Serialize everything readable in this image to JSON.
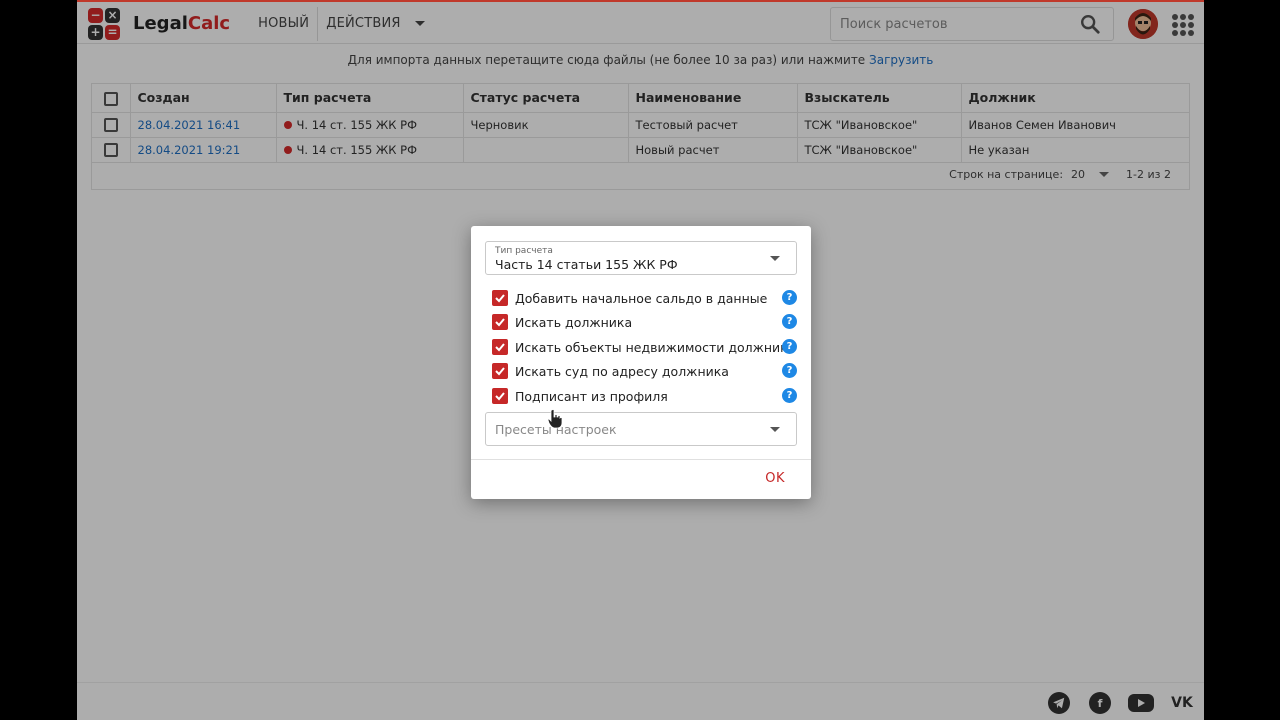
{
  "header": {
    "brand_part1": "Legal",
    "brand_part2": "Calc",
    "logo_symbols": [
      "−",
      "×",
      "+",
      "="
    ],
    "nav_new": "НОВЫЙ",
    "nav_actions": "ДЕЙСТВИЯ",
    "search_placeholder": "Поиск расчетов"
  },
  "import": {
    "text": "Для импорта данных перетащите сюда файлы (не более 10 за раз) или нажмите",
    "link": "Загрузить"
  },
  "table": {
    "columns": [
      "Создан",
      "Тип расчета",
      "Статус расчета",
      "Наименование",
      "Взыскатель",
      "Должник"
    ],
    "rows": [
      {
        "created": "28.04.2021 16:41",
        "type": "Ч. 14 ст. 155 ЖК РФ",
        "status": "Черновик",
        "name": "Тестовый расчет",
        "claimant": "ТСЖ \"Ивановское\"",
        "debtor": "Иванов Семен Иванович"
      },
      {
        "created": "28.04.2021 19:21",
        "type": "Ч. 14 ст. 155 ЖК РФ",
        "status": "",
        "name": "Новый расчет",
        "claimant": "ТСЖ \"Ивановское\"",
        "debtor": "Не указан"
      }
    ]
  },
  "pagination": {
    "rows_per_page_label": "Строк на странице:",
    "rows_per_page": "20",
    "range": "1-2 из 2"
  },
  "dialog": {
    "type_label": "Тип расчета",
    "type_value": "Часть 14 статьи 155 ЖК РФ",
    "options": [
      {
        "label": "Добавить начальное сальдо в данные",
        "checked": true
      },
      {
        "label": "Искать должника",
        "checked": true
      },
      {
        "label": "Искать объекты недвижимости должника",
        "checked": true
      },
      {
        "label": "Искать суд по адресу должника",
        "checked": true
      },
      {
        "label": "Подписант из профиля",
        "checked": true
      }
    ],
    "presets_placeholder": "Пресеты настроек",
    "ok_label": "OK"
  },
  "colors": {
    "accent": "#c62828",
    "link": "#1e6fc4",
    "help": "#1e88e5"
  }
}
